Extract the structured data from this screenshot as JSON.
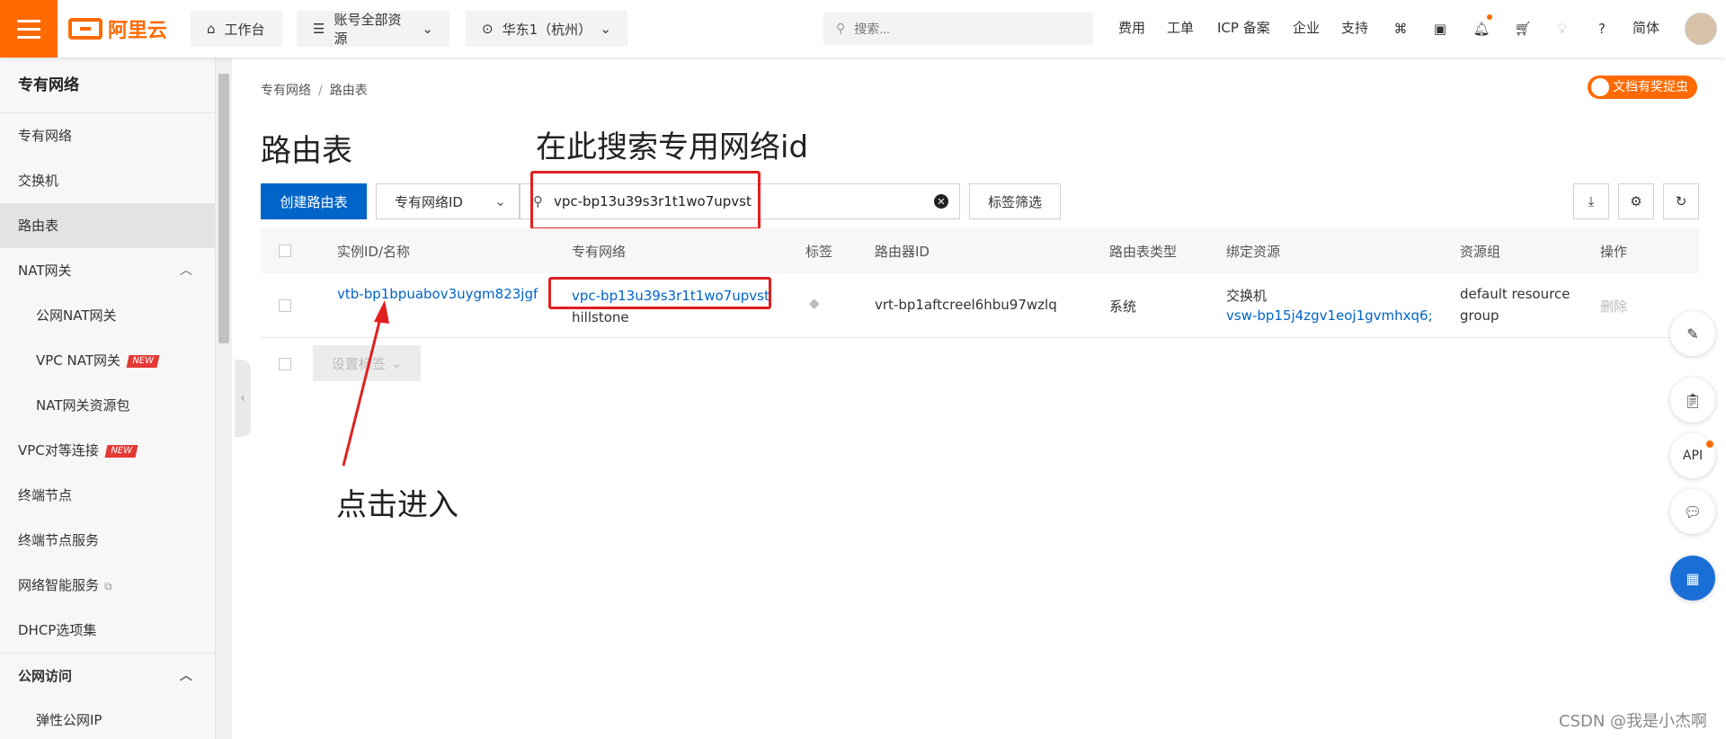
{
  "topbar": {
    "logo_text": "阿里云",
    "workbench": "工作台",
    "resources": "账号全部资源",
    "region": "华东1（杭州）",
    "search_placeholder": "搜索...",
    "links": [
      "费用",
      "工单",
      "ICP 备案",
      "企业",
      "支持"
    ],
    "lang": "简体"
  },
  "sidebar": {
    "title": "专有网络",
    "items": [
      {
        "label": "专有网络"
      },
      {
        "label": "交换机"
      },
      {
        "label": "路由表"
      },
      {
        "label": "NAT网关"
      },
      {
        "label": "公网NAT网关"
      },
      {
        "label": "VPC NAT网关",
        "badge": "NEW"
      },
      {
        "label": "NAT网关资源包"
      },
      {
        "label": "VPC对等连接",
        "badge": "NEW"
      },
      {
        "label": "终端节点"
      },
      {
        "label": "终端节点服务"
      },
      {
        "label": "网络智能服务"
      },
      {
        "label": "DHCP选项集"
      },
      {
        "label": "公网访问"
      },
      {
        "label": "弹性公网IP"
      }
    ]
  },
  "breadcrumb": [
    "专有网络",
    "路由表"
  ],
  "bug_badge": "文档有奖捉虫",
  "page_title": "路由表",
  "annotations": {
    "search_hint": "在此搜索专用网络id",
    "click_hint": "点击进入"
  },
  "toolbar": {
    "create_label": "创建路由表",
    "filter_select": "专有网络ID",
    "search_value": "vpc-bp13u39s3r1t1wo7upvst",
    "tag_filter": "标签筛选"
  },
  "table": {
    "headers": [
      "实例ID/名称",
      "专有网络",
      "标签",
      "路由器ID",
      "路由表类型",
      "绑定资源",
      "资源组",
      "操作"
    ],
    "rows": [
      {
        "instance_id": "vtb-bp1bpuabov3uygm823jgf",
        "vpc_id": "vpc-bp13u39s3r1t1wo7upvst",
        "vpc_name": "hillstone",
        "router_id": "vrt-bp1aftcreel6hbu97wzlq",
        "type": "系统",
        "bound_type": "交换机",
        "bound_id": "vsw-bp15j4zgv1eoj1gvmhxq6;",
        "resource_group_1": "default resource",
        "resource_group_2": "group",
        "action": "删除"
      }
    ],
    "batch_label": "设置标签"
  },
  "float": {
    "api_label": "API"
  },
  "watermark": "CSDN @我是小杰啊"
}
